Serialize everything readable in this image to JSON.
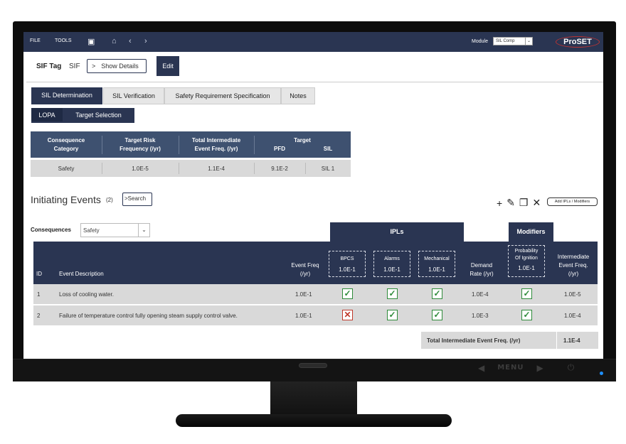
{
  "menu": {
    "file": "FILE",
    "tools": "TOOLS"
  },
  "module": {
    "label": "Module",
    "value": "SIL Comp"
  },
  "brand": "ProSET",
  "sif": {
    "tag_label": "SIF Tag",
    "tag_value": "SIF",
    "show_details": "Show Details",
    "edit": "Edit"
  },
  "tabs": [
    "SIL Determination",
    "SIL Verification",
    "Safety Requirement Specification",
    "Notes"
  ],
  "subtabs": [
    "LOPA",
    "Target Selection"
  ],
  "consequence_table": {
    "headers": {
      "category": [
        "Consequence",
        "Category"
      ],
      "risk": [
        "Target Risk",
        "Frequency (/yr)"
      ],
      "tief": [
        "Total Intermediate",
        "Event Freq. (/yr)"
      ],
      "target": "Target",
      "pfd": "PFD",
      "sil": "SIL"
    },
    "row": {
      "category": "Safety",
      "risk": "1.0E-5",
      "tief": "1.1E-4",
      "pfd": "9.1E-2",
      "sil": "SIL 1"
    }
  },
  "initiating": {
    "title": "Initiating Events",
    "count": "(2)",
    "search": "Search",
    "add_ipl": "Add IPLs / Modifiers"
  },
  "consequences": {
    "label": "Consequences",
    "value": "Safety"
  },
  "group_headers": {
    "ipls": "IPLs",
    "modifiers": "Modifiers"
  },
  "events_table": {
    "headers": {
      "id": "ID",
      "description": "Event Description",
      "event_freq": [
        "Event Freq",
        "(/yr)"
      ],
      "bpcs": {
        "name": "BPCS",
        "value": "1.0E-1"
      },
      "alarms": {
        "name": "Alarms",
        "value": "1.0E-1"
      },
      "mechanical": {
        "name": "Mechanical",
        "value": "1.0E-1"
      },
      "demand": [
        "Demand",
        "Rate (/yr)"
      ],
      "ignition": {
        "name": [
          "Probability",
          "Of Ignition"
        ],
        "value": "1.0E-1"
      },
      "intermediate": [
        "Intermediate",
        "Event Freq.",
        "(/yr)"
      ]
    },
    "rows": [
      {
        "id": "1",
        "description": "Loss of cooling water.",
        "event_freq": "1.0E-1",
        "bpcs": true,
        "alarms": true,
        "mechanical": true,
        "demand": "1.0E-4",
        "ignition": true,
        "intermediate": "1.0E-5"
      },
      {
        "id": "2",
        "description": "Failure of temperature control fully opening steam supply control valve.",
        "event_freq": "1.0E-1",
        "bpcs": false,
        "alarms": true,
        "mechanical": true,
        "demand": "1.0E-3",
        "ignition": true,
        "intermediate": "1.0E-4"
      }
    ]
  },
  "total": {
    "label": "Total Intermediate Event Freq. (/yr)",
    "value": "1.1E-4"
  },
  "monitor": {
    "menu": "MENU"
  },
  "colors": {
    "navy": "#2a3552",
    "header_blue": "#3e5170",
    "check_green": "#2e8b3a",
    "cross_red": "#c0392b"
  }
}
